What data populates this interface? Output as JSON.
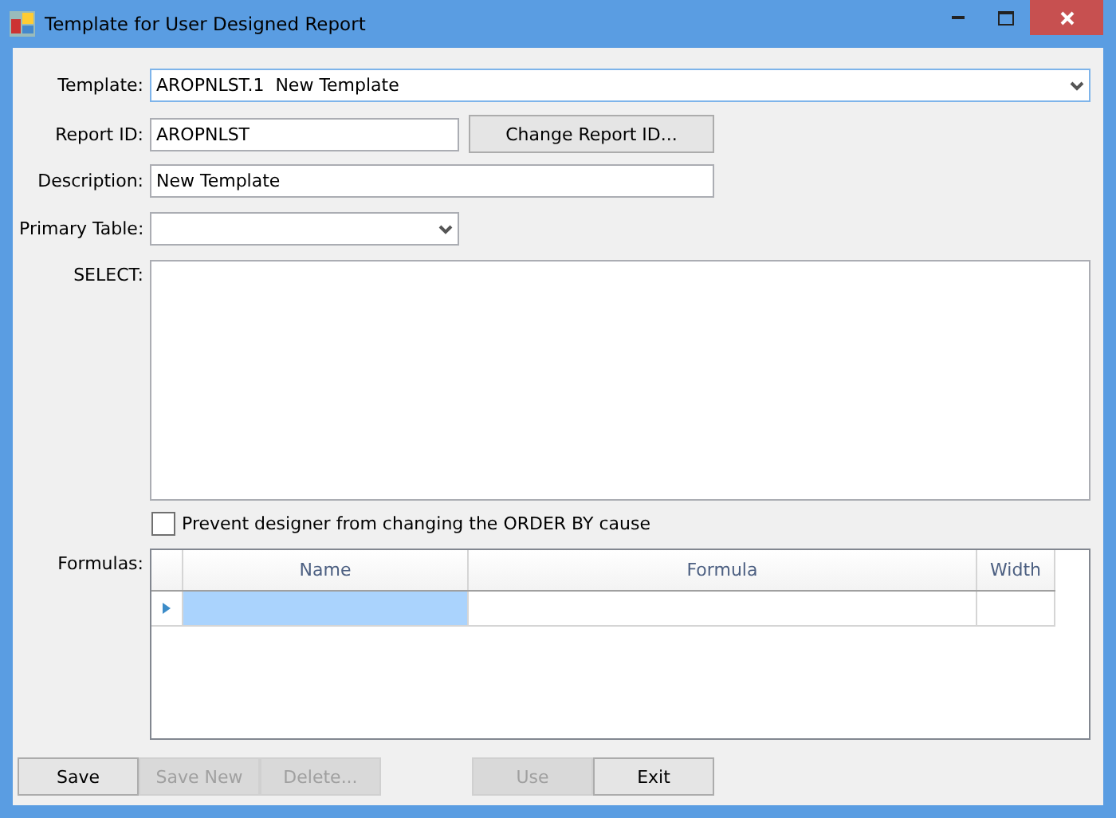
{
  "window": {
    "title": "Template for User Designed Report"
  },
  "template": {
    "label": "Template:",
    "value": "AROPNLST.1  New Template"
  },
  "report_id": {
    "label": "Report ID:",
    "value": "AROPNLST",
    "button": "Change Report ID..."
  },
  "description": {
    "label": "Description:",
    "value": "New Template"
  },
  "primary_table": {
    "label": "Primary Table:"
  },
  "select": {
    "label": "SELECT:"
  },
  "prevent_order_by": {
    "label": "Prevent designer from changing the ORDER BY cause",
    "checked": false
  },
  "formulas": {
    "label": "Formulas:",
    "columns": [
      "Name",
      "Formula",
      "Width"
    ],
    "rows": [
      {
        "selected": true
      }
    ]
  },
  "buttons_left": [
    {
      "label": "Save",
      "disabled": false
    },
    {
      "label": "Save New",
      "disabled": true
    },
    {
      "label": "Delete...",
      "disabled": true
    }
  ],
  "buttons_right": [
    {
      "label": "Use",
      "disabled": true
    },
    {
      "label": "Exit",
      "disabled": false
    }
  ]
}
